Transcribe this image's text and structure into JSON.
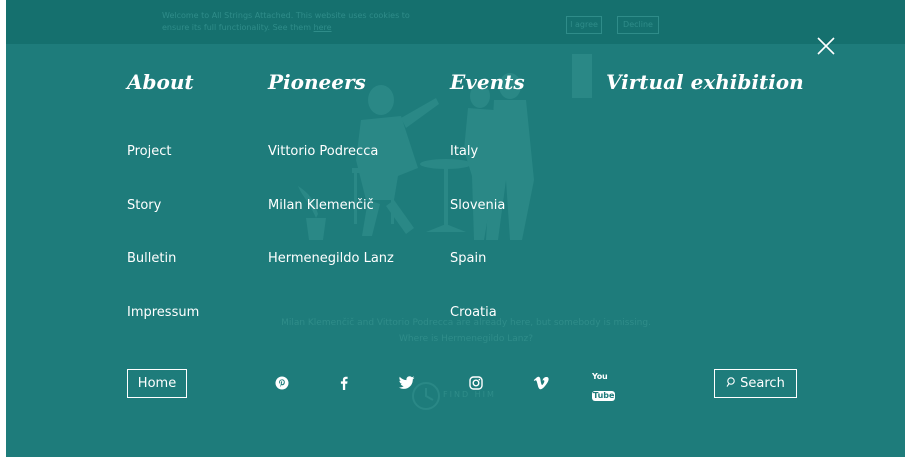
{
  "cookie_bar": {
    "message": "Welcome to All Strings Attached. This website uses cookies to ensure its full functionality. See them",
    "link": "here",
    "agree_label": "I agree",
    "decline_label": "Decline"
  },
  "menu": {
    "columns": [
      {
        "title": "About",
        "items": [
          "Project",
          "Story",
          "Bulletin",
          "Impressum"
        ]
      },
      {
        "title": "Pioneers",
        "items": [
          "Vittorio Podrecca",
          "Milan Klemenčič",
          "Hermenegildo Lanz"
        ]
      },
      {
        "title": "Events",
        "items": [
          "Italy",
          "Slovenia",
          "Spain",
          "Croatia"
        ]
      },
      {
        "title": "Virtual exhibition",
        "items": []
      }
    ]
  },
  "footer": {
    "home_label": "Home",
    "search_label": "Search",
    "social": [
      {
        "name": "pinterest"
      },
      {
        "name": "facebook"
      },
      {
        "name": "twitter"
      },
      {
        "name": "instagram"
      },
      {
        "name": "vimeo"
      },
      {
        "name": "youtube",
        "text_a": "You",
        "text_b": "Tube"
      }
    ]
  },
  "background": {
    "caption_line1": "Milan Klemenčič and Vittorio Podrecca are already here, but somebody is missing.",
    "caption_line2": "Where is Hermenegildo Lanz?",
    "find_label": "FIND HIM"
  },
  "colors": {
    "overlay": "#1e7c7b",
    "cookie_bar": "#15706e",
    "text": "#ffffff",
    "faded": "#2f8c89"
  }
}
